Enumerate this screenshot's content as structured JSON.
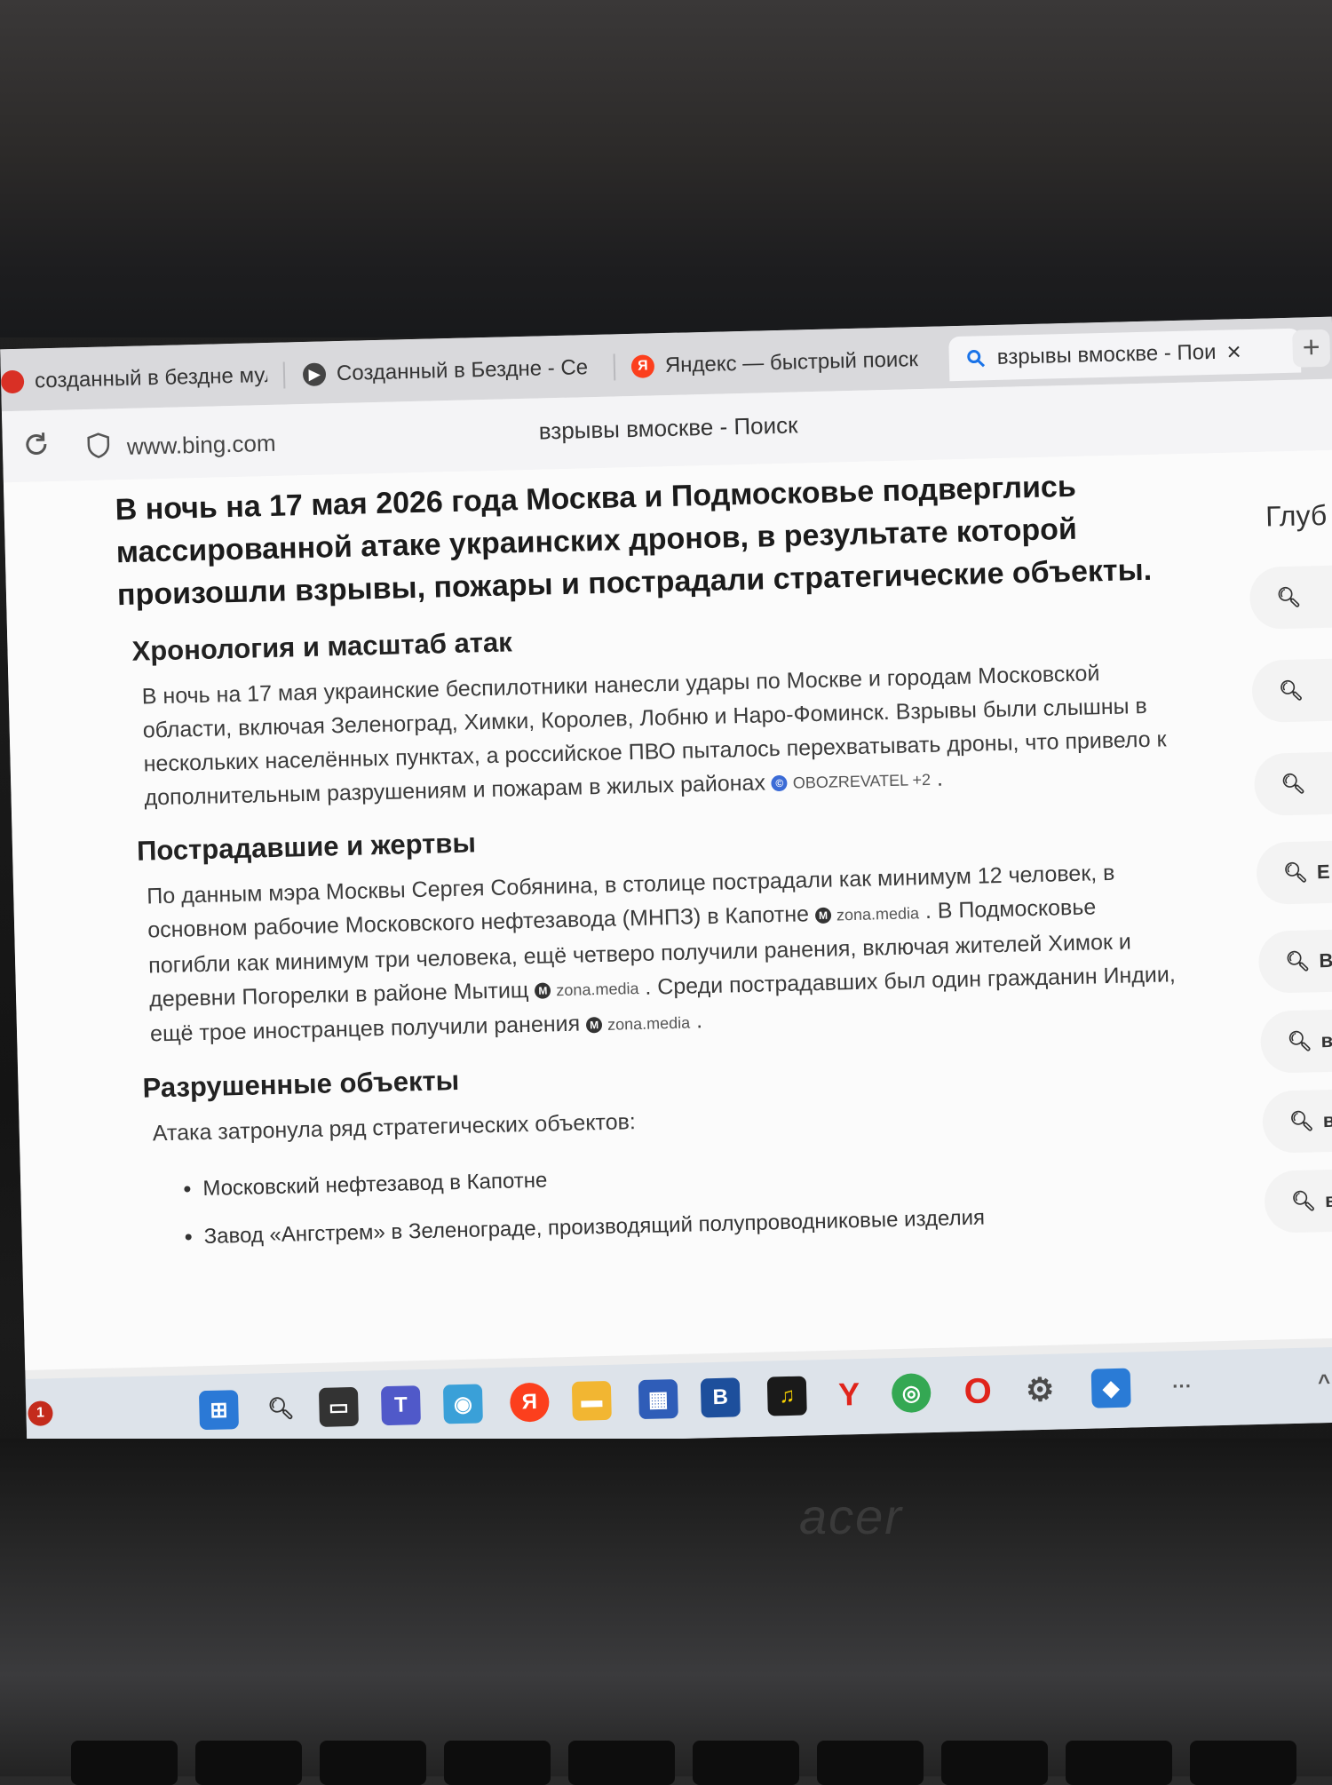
{
  "browser": {
    "tabs": [
      {
        "label": "созданный в бездне муль",
        "icon": "red-dot-icon",
        "color": "#d93025"
      },
      {
        "label": "Созданный в Бездне - Се",
        "icon": "play-icon",
        "color": "#c0392b"
      },
      {
        "label": "Яндекс — быстрый поиск",
        "icon": "yandex-icon",
        "color": "#fc3f1d"
      },
      {
        "label": "взрывы вмоскве - Пои",
        "icon": "search-icon",
        "color": "#1a73e8",
        "active": true
      }
    ],
    "close_symbol": "×",
    "new_tab_symbol": "+",
    "url": "www.bing.com",
    "page_title": "взрывы вмоскве - Поиск"
  },
  "article": {
    "lead": "В ночь на 17 мая 2026 года Москва и Подмосковье подверглись массированной атаке украинских дронов, в результате которой произошли взрывы, пожары и пострадали стратегические объекты.",
    "sections": [
      {
        "title": "Хронология и масштаб атак",
        "text": "В ночь на 17 мая украинские беспилотники нанесли удары по Москве и городам Московской области, включая Зеленоград, Химки, Королев, Лобню и Наро-Фоминск. Взрывы были слышны в нескольких населённых пунктах, а российское ПВО пыталось перехватывать дроны, что привело к дополнительным разрушениям и пожарам в жилых районах",
        "source": "OBOZREVATEL +2"
      },
      {
        "title": "Пострадавшие и жертвы",
        "text1": "По данным мэра Москвы Сергея Собянина, в столице пострадали как минимум 12 человек, в основном рабочие Московского нефтезавода (МНПЗ) в Капотне",
        "source1": "zona.media",
        "text2": "В Подмосковье погибли как минимум три человека, ещё четверо получили ранения, включая жителей Химок и деревни Погорелки в районе Мытищ",
        "source2": "zona.media",
        "text3": "Среди пострадавших был один гражданин Индии, ещё трое иностранцев получили ранения",
        "source3": "zona.media"
      },
      {
        "title": "Разрушенные объекты",
        "text": "Атака затронула ряд стратегических объектов:",
        "items": [
          "Московский нефтезавод в Капотне",
          "Завод «Ангстрем» в Зеленограде, производящий полупроводниковые изделия"
        ]
      }
    ]
  },
  "sidebar": {
    "title": "Глуб",
    "items": [
      "",
      "",
      "",
      "Е Н",
      "В П",
      "вз",
      "взр",
      "взр"
    ]
  },
  "taskbar": {
    "notification_count": "1",
    "icons": [
      "start-icon",
      "search-icon",
      "task-view-icon",
      "teams-icon",
      "browser-icon",
      "yandex-icon",
      "file-explorer-icon",
      "store-icon",
      "vk-icon",
      "yandex-music-icon",
      "yandex-browser-icon",
      "chrome-icon",
      "opera-icon",
      "settings-icon",
      "app-icon",
      "more-icon"
    ],
    "overflow_symbol": "···",
    "chevron_symbol": "^"
  },
  "laptop": {
    "brand": "acer"
  }
}
